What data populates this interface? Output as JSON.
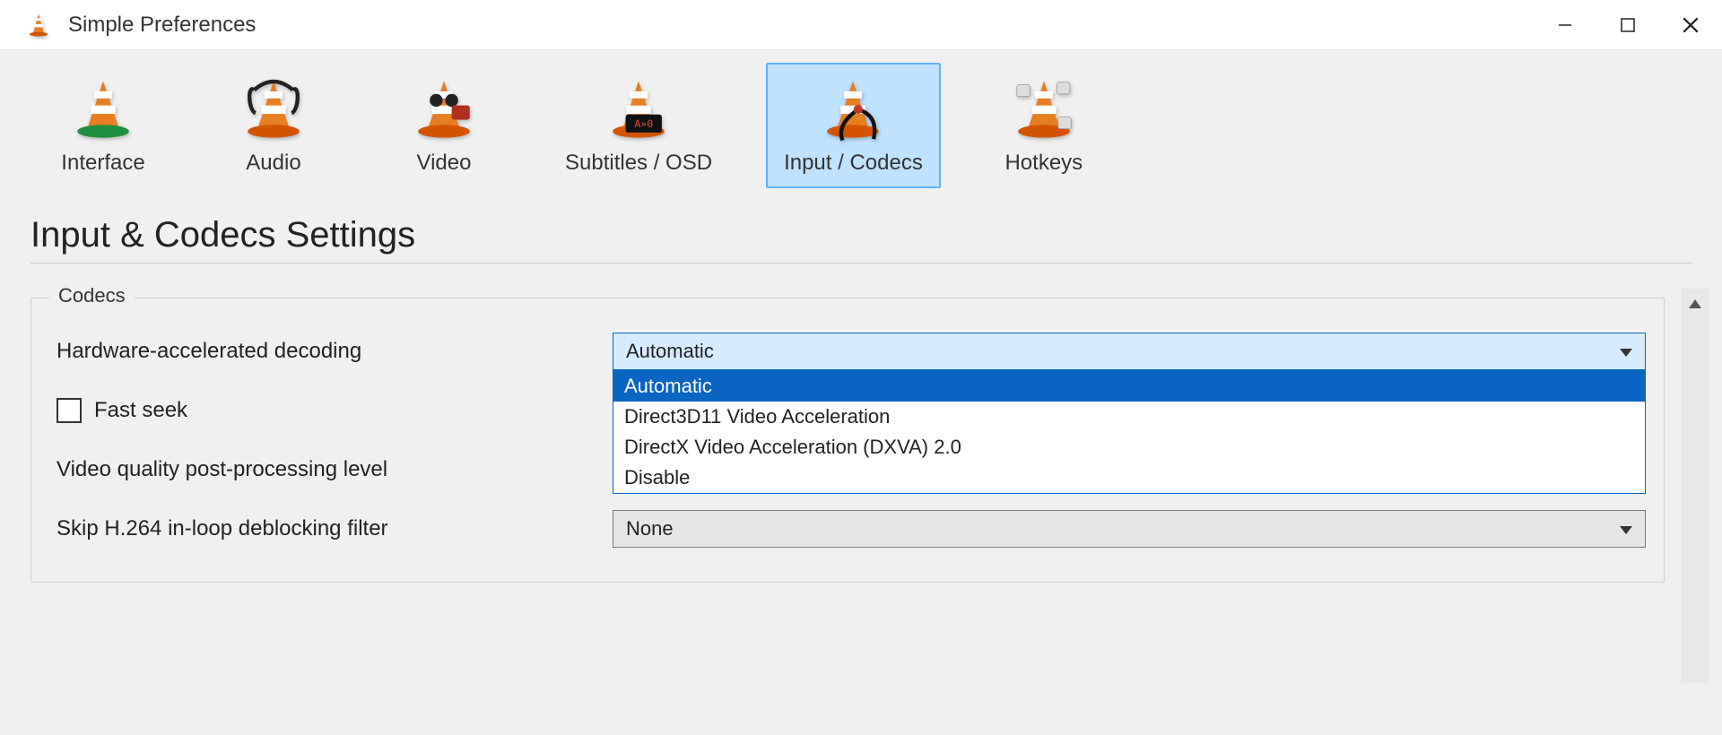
{
  "window": {
    "title": "Simple Preferences"
  },
  "tabs": [
    {
      "id": "interface",
      "label": "Interface"
    },
    {
      "id": "audio",
      "label": "Audio"
    },
    {
      "id": "video",
      "label": "Video"
    },
    {
      "id": "subtitles",
      "label": "Subtitles / OSD"
    },
    {
      "id": "input-codecs",
      "label": "Input / Codecs",
      "selected": true
    },
    {
      "id": "hotkeys",
      "label": "Hotkeys"
    }
  ],
  "section": {
    "heading": "Input & Codecs Settings"
  },
  "codecs": {
    "legend": "Codecs",
    "hw_decoding": {
      "label": "Hardware-accelerated decoding",
      "value": "Automatic",
      "options": [
        "Automatic",
        "Direct3D11 Video Acceleration",
        "DirectX Video Acceleration (DXVA) 2.0",
        "Disable"
      ],
      "open": true,
      "selected_index": 0
    },
    "fast_seek": {
      "label": "Fast seek",
      "checked": false
    },
    "vq_post": {
      "label": "Video quality post-processing level"
    },
    "skip_h264": {
      "label": "Skip H.264 in-loop deblocking filter",
      "value": "None"
    }
  }
}
